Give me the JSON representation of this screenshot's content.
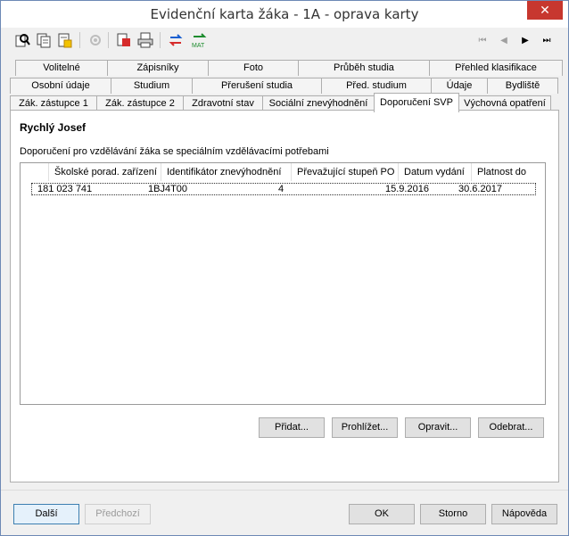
{
  "window": {
    "title": "Evidenční karta žáka - 1A - oprava karty",
    "close_glyph": "✕"
  },
  "toolbar": {
    "nav_first": "⏮",
    "nav_prev": "◀",
    "nav_next": "▶",
    "nav_last": "⏭",
    "mat_label": "MAT"
  },
  "tabs": {
    "row1": [
      "Volitelné",
      "Zápisníky",
      "Foto",
      "Průběh studia",
      "Přehled klasifikace"
    ],
    "row2": [
      "Osobní údaje",
      "Studium",
      "Přerušení studia",
      "Před. studium",
      "Údaje",
      "Bydliště"
    ],
    "row3": [
      "Zák. zástupce 1",
      "Zák. zástupce 2",
      "Zdravotní stav",
      "Sociální znevýhodnění",
      "Doporučení SVP",
      "Výchovná opatření"
    ],
    "active": "Doporučení SVP"
  },
  "panel": {
    "student_name": "Rychlý Josef",
    "section_label": "Doporučení pro vzdělávání žáka se speciálním vzdělávacími potřebami"
  },
  "table": {
    "columns": [
      "Školské porad. zařízení",
      "Identifikátor znevýhodnění",
      "Převažující stupeň PO",
      "Datum vydání",
      "Platnost do"
    ],
    "rows": [
      [
        "181 023 741",
        "1BJ4T00",
        "4",
        "15.9.2016",
        "30.6.2017"
      ]
    ]
  },
  "actions": {
    "add": "Přidat...",
    "view": "Prohlížet...",
    "edit": "Opravit...",
    "remove": "Odebrat..."
  },
  "footer": {
    "next": "Další",
    "prev": "Předchozí",
    "ok": "OK",
    "cancel": "Storno",
    "help": "Nápověda"
  }
}
